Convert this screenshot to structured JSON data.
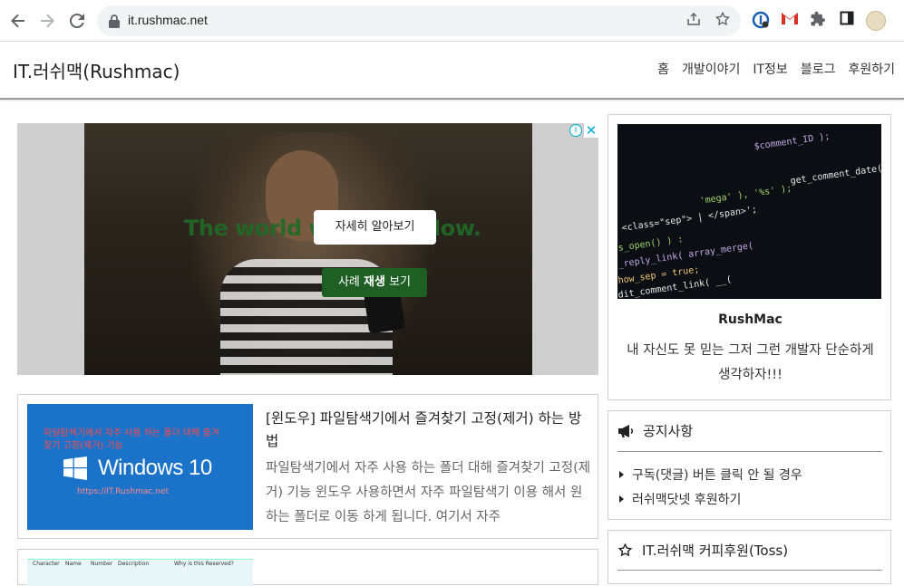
{
  "browser": {
    "url": "it.rushmac.net"
  },
  "site": {
    "title": "IT.러쉬맥(Rushmac)",
    "nav": [
      "홈",
      "개발이야기",
      "IT정보",
      "블로그",
      "후원하기"
    ]
  },
  "ad": {
    "background_text": "The world w ServiceNow.",
    "learn_more": "자세히 알아보기",
    "watch_case_prefix": "사례 ",
    "watch_case_bold": "재생",
    "watch_case_suffix": " 보기",
    "info_label": "i",
    "close_label": "✕"
  },
  "posts": [
    {
      "title": "[윈도우] 파일탐색기에서 즐겨찾기 고정(제거) 하는 방법",
      "excerpt": "파일탐색기에서 자주 사용 하는 폴더 대해 즐겨찾기 고정(제거) 기능 윈도우 사용하면서 자주 파일탐색기 이용 해서 원하는 폴더로 이동 하게 됩니다. 여기서 자주",
      "thumb_caption": "파일탐색기에서 자주 사용 하는 폴더 대해 즐겨찾기 고정(제거) 기능",
      "thumb_brand": "Windows 10",
      "thumb_url": "https://IT.Rushmac.net"
    },
    {
      "thumb_headers": [
        "Character",
        "Name",
        "Number",
        "Description",
        "Why is this Reserved?"
      ]
    }
  ],
  "sidebar": {
    "profile_name": "RushMac",
    "profile_desc": "내 자신도 못 믿는 그저 그런 개발자 단순하게 생각하자!!!",
    "code_lines": [
      "<class=\"sep\"> | </span>';",
      "s_open() ) :",
      "_reply_link( array_merge(",
      "how_sep = true;",
      "dit_comment_link( __(",
      "$comment_ID );",
      "get_comment_date('M j,",
      "'mega' ), '%s' );"
    ],
    "notice_title": "공지사항",
    "notice_items": [
      "구독(댓글) 버튼 클릭 안 될 경우",
      "러쉬맥닷넷 후원하기"
    ],
    "toss_title": "IT.러쉬맥 커피후원(Toss)"
  },
  "colors": {
    "ad_green": "#1f5f24",
    "thumb_blue": "#1a73c9",
    "info_cyan": "#00aecd"
  }
}
